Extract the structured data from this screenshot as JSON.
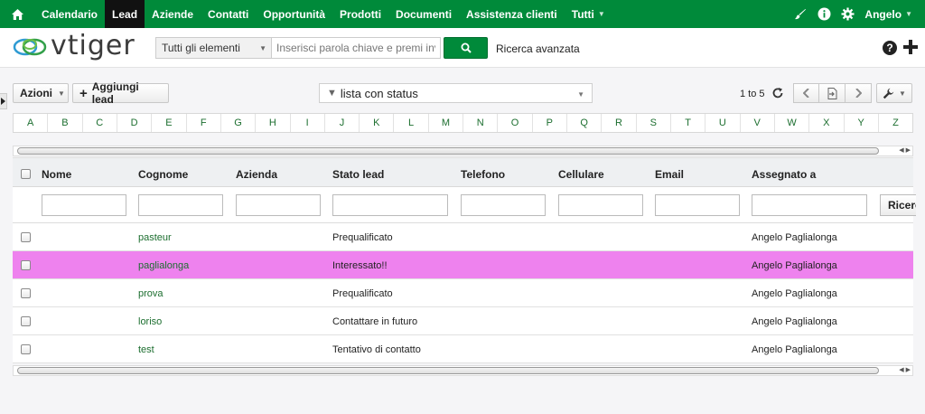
{
  "nav": {
    "items": [
      {
        "label": "Calendario",
        "active": false
      },
      {
        "label": "Lead",
        "active": true
      },
      {
        "label": "Aziende",
        "active": false
      },
      {
        "label": "Contatti",
        "active": false
      },
      {
        "label": "Opportunità",
        "active": false
      },
      {
        "label": "Prodotti",
        "active": false
      },
      {
        "label": "Documenti",
        "active": false
      },
      {
        "label": "Assistenza clienti",
        "active": false
      },
      {
        "label": "Tutti",
        "active": false,
        "dropdown": true
      }
    ],
    "user": "Angelo",
    "icons": [
      "home-icon",
      "brush-icon",
      "info-icon",
      "gear-icon"
    ]
  },
  "header": {
    "logo_text": "vtiger",
    "search_scope": "Tutti gli elementi",
    "search_placeholder": "Inserisci parola chiave e premi invio",
    "advanced_search": "Ricerca avanzata"
  },
  "toolbar": {
    "actions_label": "Azioni",
    "add_label": "Aggiungi lead",
    "filter_label": "lista con status",
    "page_info": "1 to 5"
  },
  "alphabet": [
    "A",
    "B",
    "C",
    "D",
    "E",
    "F",
    "G",
    "H",
    "I",
    "J",
    "K",
    "L",
    "M",
    "N",
    "O",
    "P",
    "Q",
    "R",
    "S",
    "T",
    "U",
    "V",
    "W",
    "X",
    "Y",
    "Z"
  ],
  "table": {
    "columns": [
      "Nome",
      "Cognome",
      "Azienda",
      "Stato lead",
      "Telefono",
      "Cellulare",
      "Email",
      "Assegnato a"
    ],
    "search_button": "Ricerca",
    "rows": [
      {
        "nome": "",
        "cognome": "pasteur",
        "azienda": "",
        "stato": "Prequalificato",
        "telefono": "",
        "cellulare": "",
        "email": "",
        "assegnato": "Angelo Paglialonga",
        "highlight": false
      },
      {
        "nome": "",
        "cognome": "paglialonga",
        "azienda": "",
        "stato": "Interessato!!",
        "telefono": "",
        "cellulare": "",
        "email": "",
        "assegnato": "Angelo Paglialonga",
        "highlight": true
      },
      {
        "nome": "",
        "cognome": "prova",
        "azienda": "",
        "stato": "Prequalificato",
        "telefono": "",
        "cellulare": "",
        "email": "",
        "assegnato": "Angelo Paglialonga",
        "highlight": false
      },
      {
        "nome": "",
        "cognome": "loriso",
        "azienda": "",
        "stato": "Contattare in futuro",
        "telefono": "",
        "cellulare": "",
        "email": "",
        "assegnato": "Angelo Paglialonga",
        "highlight": false
      },
      {
        "nome": "",
        "cognome": "test",
        "azienda": "",
        "stato": "Tentativo di contatto",
        "telefono": "",
        "cellulare": "",
        "email": "",
        "assegnato": "Angelo Paglialonga",
        "highlight": false
      }
    ]
  },
  "colors": {
    "brand_green": "#008a3a",
    "highlight_row": "#ee82ee",
    "link_green": "#1c6e2f"
  }
}
